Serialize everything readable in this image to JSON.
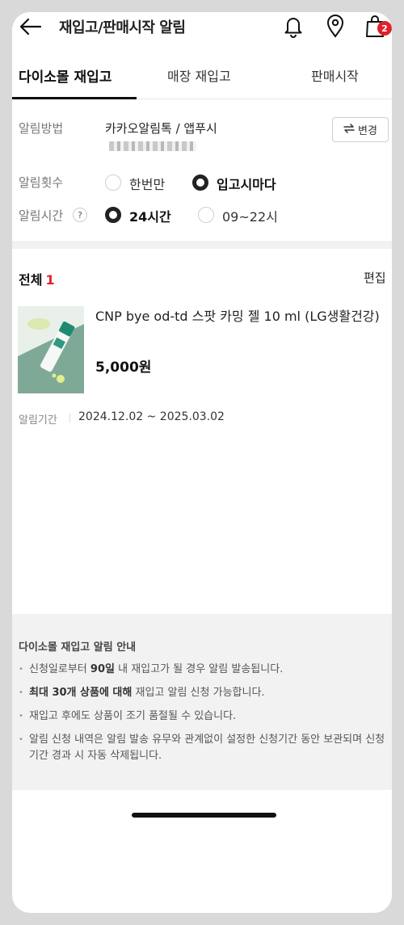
{
  "header": {
    "title": "재입고/판매시작 알림",
    "back_icon": "arrow-left-icon",
    "icons": [
      "bell-icon",
      "location-pin-icon",
      "shopping-bag-icon"
    ],
    "cart_badge": "2"
  },
  "tabs": [
    {
      "label": "다이소몰 재입고",
      "active": true
    },
    {
      "label": "매장 재입고",
      "active": false
    },
    {
      "label": "판매시작",
      "active": false
    }
  ],
  "settings": {
    "method_label": "알림방법",
    "method_value": "카카오알림톡 / 앱푸시",
    "change_button": "변경",
    "count_label": "알림횟수",
    "count_options": [
      {
        "label": "한번만",
        "selected": false
      },
      {
        "label": "입고시마다",
        "selected": true
      }
    ],
    "time_label": "알림시간",
    "time_help": "?",
    "time_options": [
      {
        "label": "24시간",
        "selected": true
      },
      {
        "label": "09~22시",
        "selected": false
      }
    ]
  },
  "list": {
    "total_label": "전체",
    "total_count": "1",
    "edit_label": "편집",
    "items": [
      {
        "name": "CNP bye od-td 스팟 카밍 젤 10 ml (LG생활건강)",
        "price": "5,000원",
        "period_label": "알림기간",
        "period": "2024.12.02 ~ 2025.03.02"
      }
    ]
  },
  "guide": {
    "title": "다이소몰 재입고 알림 안내",
    "items": [
      {
        "pre": "신청일로부터 ",
        "bold": "90일",
        "post": " 내 재입고가 될 경우 알림 발송됩니다."
      },
      {
        "pre": "",
        "bold": "최대 30개 상품에 대해",
        "post": " 재입고 알림 신청 가능합니다."
      },
      {
        "pre": "재입고 후에도 상품이 조기 품절될 수 있습니다.",
        "bold": "",
        "post": ""
      },
      {
        "pre": "알림 신청 내역은 알림 발송 유무와 관계없이 설정한 신청기간 동안 보관되며 신청기간 경과 시 자동 삭제됩니다.",
        "bold": "",
        "post": ""
      }
    ]
  },
  "colors": {
    "accent": "#e0202a",
    "selected_radio": "#222222",
    "guide_bg": "#f2f2f2"
  }
}
